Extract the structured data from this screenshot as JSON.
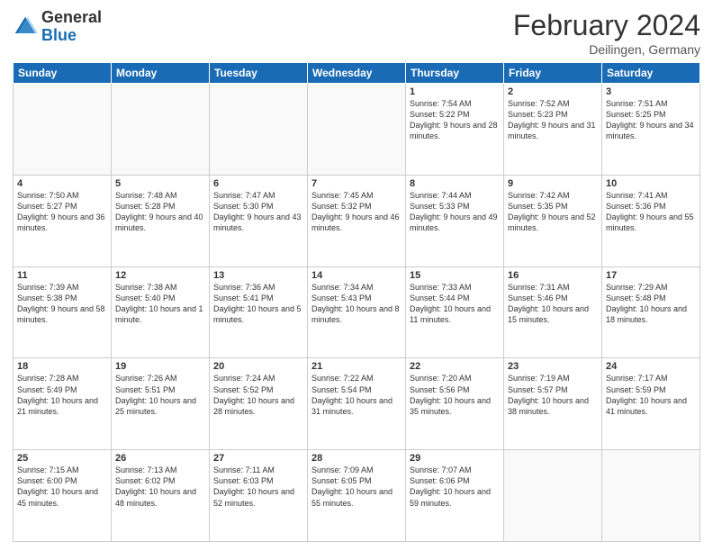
{
  "logo": {
    "general": "General",
    "blue": "Blue"
  },
  "header": {
    "month": "February 2024",
    "location": "Deilingen, Germany"
  },
  "weekdays": [
    "Sunday",
    "Monday",
    "Tuesday",
    "Wednesday",
    "Thursday",
    "Friday",
    "Saturday"
  ],
  "weeks": [
    [
      {
        "day": "",
        "info": ""
      },
      {
        "day": "",
        "info": ""
      },
      {
        "day": "",
        "info": ""
      },
      {
        "day": "",
        "info": ""
      },
      {
        "day": "1",
        "info": "Sunrise: 7:54 AM\nSunset: 5:22 PM\nDaylight: 9 hours and 28 minutes."
      },
      {
        "day": "2",
        "info": "Sunrise: 7:52 AM\nSunset: 5:23 PM\nDaylight: 9 hours and 31 minutes."
      },
      {
        "day": "3",
        "info": "Sunrise: 7:51 AM\nSunset: 5:25 PM\nDaylight: 9 hours and 34 minutes."
      }
    ],
    [
      {
        "day": "4",
        "info": "Sunrise: 7:50 AM\nSunset: 5:27 PM\nDaylight: 9 hours and 36 minutes."
      },
      {
        "day": "5",
        "info": "Sunrise: 7:48 AM\nSunset: 5:28 PM\nDaylight: 9 hours and 40 minutes."
      },
      {
        "day": "6",
        "info": "Sunrise: 7:47 AM\nSunset: 5:30 PM\nDaylight: 9 hours and 43 minutes."
      },
      {
        "day": "7",
        "info": "Sunrise: 7:45 AM\nSunset: 5:32 PM\nDaylight: 9 hours and 46 minutes."
      },
      {
        "day": "8",
        "info": "Sunrise: 7:44 AM\nSunset: 5:33 PM\nDaylight: 9 hours and 49 minutes."
      },
      {
        "day": "9",
        "info": "Sunrise: 7:42 AM\nSunset: 5:35 PM\nDaylight: 9 hours and 52 minutes."
      },
      {
        "day": "10",
        "info": "Sunrise: 7:41 AM\nSunset: 5:36 PM\nDaylight: 9 hours and 55 minutes."
      }
    ],
    [
      {
        "day": "11",
        "info": "Sunrise: 7:39 AM\nSunset: 5:38 PM\nDaylight: 9 hours and 58 minutes."
      },
      {
        "day": "12",
        "info": "Sunrise: 7:38 AM\nSunset: 5:40 PM\nDaylight: 10 hours and 1 minute."
      },
      {
        "day": "13",
        "info": "Sunrise: 7:36 AM\nSunset: 5:41 PM\nDaylight: 10 hours and 5 minutes."
      },
      {
        "day": "14",
        "info": "Sunrise: 7:34 AM\nSunset: 5:43 PM\nDaylight: 10 hours and 8 minutes."
      },
      {
        "day": "15",
        "info": "Sunrise: 7:33 AM\nSunset: 5:44 PM\nDaylight: 10 hours and 11 minutes."
      },
      {
        "day": "16",
        "info": "Sunrise: 7:31 AM\nSunset: 5:46 PM\nDaylight: 10 hours and 15 minutes."
      },
      {
        "day": "17",
        "info": "Sunrise: 7:29 AM\nSunset: 5:48 PM\nDaylight: 10 hours and 18 minutes."
      }
    ],
    [
      {
        "day": "18",
        "info": "Sunrise: 7:28 AM\nSunset: 5:49 PM\nDaylight: 10 hours and 21 minutes."
      },
      {
        "day": "19",
        "info": "Sunrise: 7:26 AM\nSunset: 5:51 PM\nDaylight: 10 hours and 25 minutes."
      },
      {
        "day": "20",
        "info": "Sunrise: 7:24 AM\nSunset: 5:52 PM\nDaylight: 10 hours and 28 minutes."
      },
      {
        "day": "21",
        "info": "Sunrise: 7:22 AM\nSunset: 5:54 PM\nDaylight: 10 hours and 31 minutes."
      },
      {
        "day": "22",
        "info": "Sunrise: 7:20 AM\nSunset: 5:56 PM\nDaylight: 10 hours and 35 minutes."
      },
      {
        "day": "23",
        "info": "Sunrise: 7:19 AM\nSunset: 5:57 PM\nDaylight: 10 hours and 38 minutes."
      },
      {
        "day": "24",
        "info": "Sunrise: 7:17 AM\nSunset: 5:59 PM\nDaylight: 10 hours and 41 minutes."
      }
    ],
    [
      {
        "day": "25",
        "info": "Sunrise: 7:15 AM\nSunset: 6:00 PM\nDaylight: 10 hours and 45 minutes."
      },
      {
        "day": "26",
        "info": "Sunrise: 7:13 AM\nSunset: 6:02 PM\nDaylight: 10 hours and 48 minutes."
      },
      {
        "day": "27",
        "info": "Sunrise: 7:11 AM\nSunset: 6:03 PM\nDaylight: 10 hours and 52 minutes."
      },
      {
        "day": "28",
        "info": "Sunrise: 7:09 AM\nSunset: 6:05 PM\nDaylight: 10 hours and 55 minutes."
      },
      {
        "day": "29",
        "info": "Sunrise: 7:07 AM\nSunset: 6:06 PM\nDaylight: 10 hours and 59 minutes."
      },
      {
        "day": "",
        "info": ""
      },
      {
        "day": "",
        "info": ""
      }
    ]
  ]
}
